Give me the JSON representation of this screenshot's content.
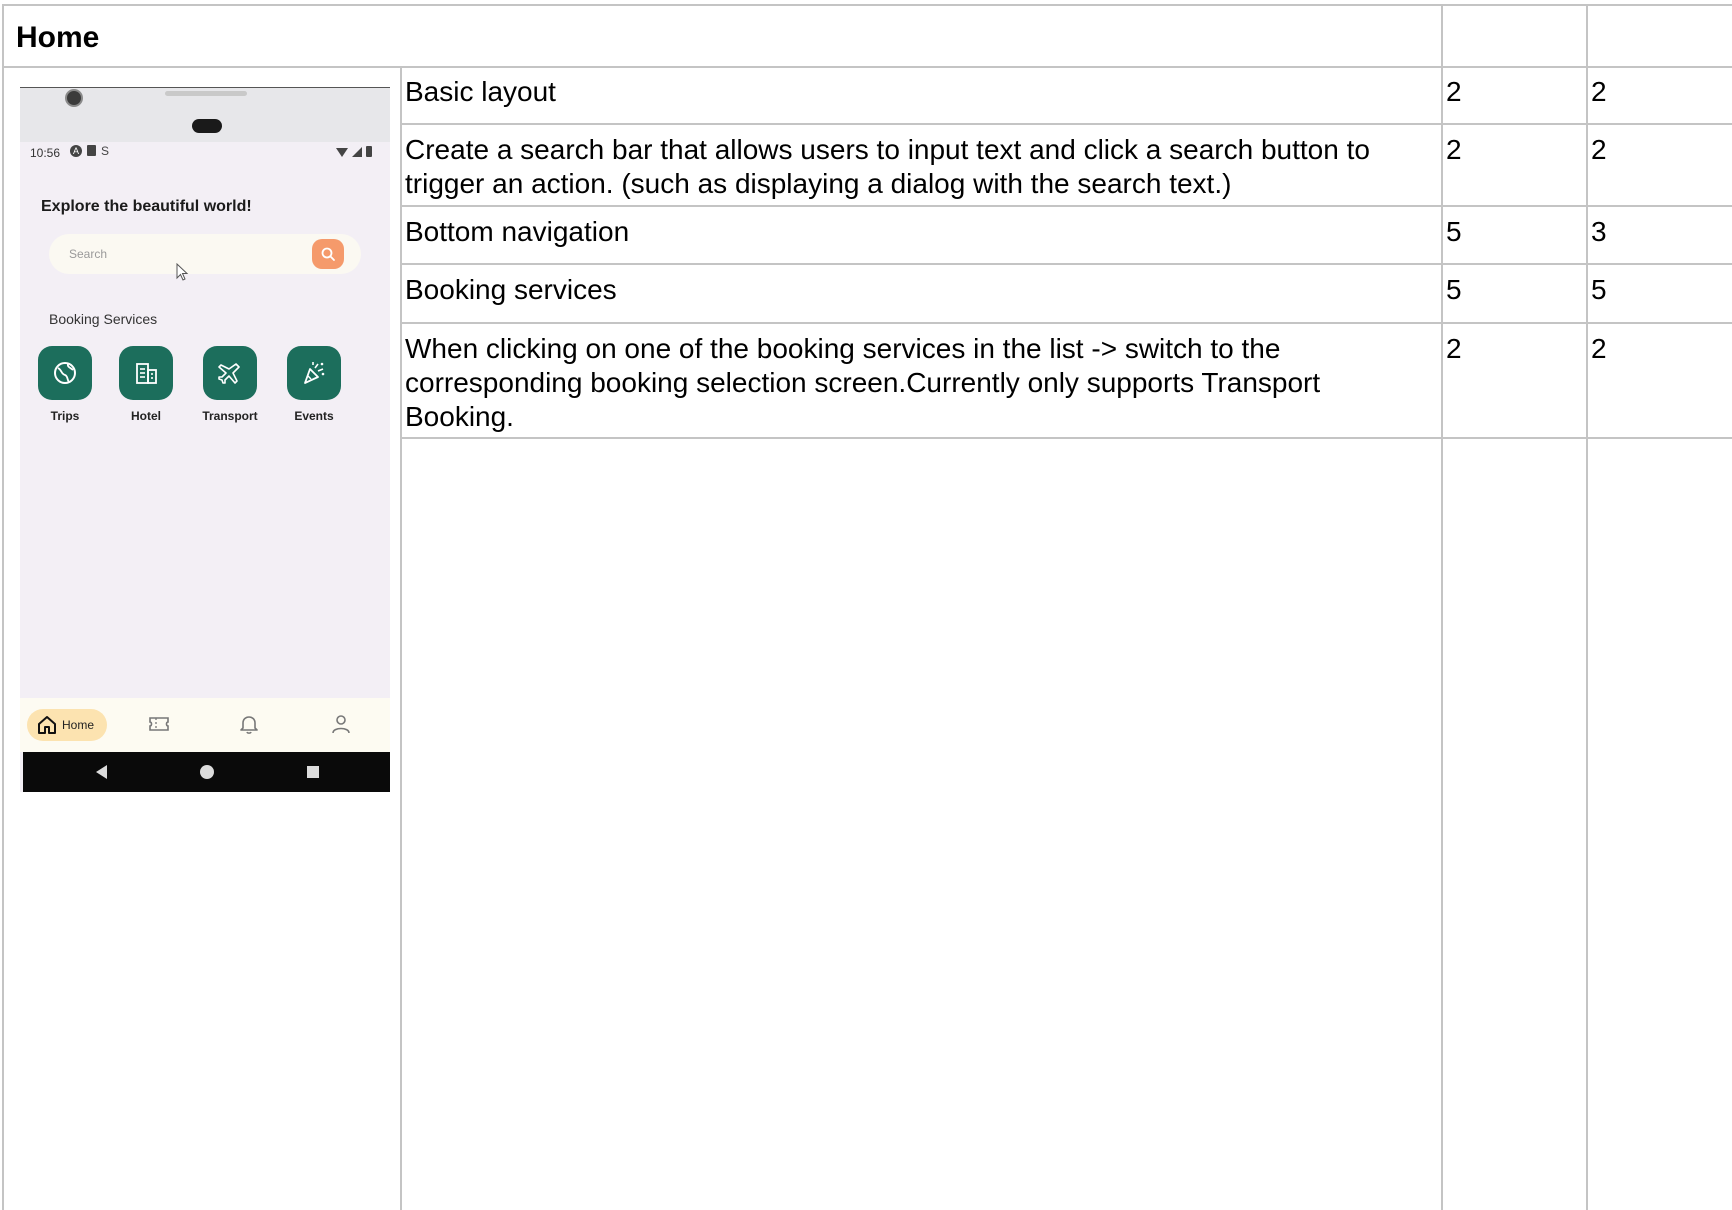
{
  "section_title": "Home",
  "rows": [
    {
      "requirement": "Basic layout",
      "col_a": "2",
      "col_b": "2"
    },
    {
      "requirement": "Create a search bar that allows users to input text and click a search button to trigger an action. (such as displaying a dialog with the search text.)",
      "col_a": "2",
      "col_b": "2"
    },
    {
      "requirement": "Bottom navigation",
      "col_a": "5",
      "col_b": "3"
    },
    {
      "requirement": "Booking services",
      "col_a": "5",
      "col_b": "5"
    },
    {
      "requirement": "When clicking on one of the booking services in the list -> switch to the corresponding booking selection screen.Currently only supports Transport Booking.",
      "col_a": "2",
      "col_b": "2"
    }
  ],
  "phone": {
    "status_time": "10:56",
    "headline": "Explore the beautiful world!",
    "search_placeholder": "Search",
    "booking_services_label": "Booking Services",
    "services": [
      {
        "label": "Trips",
        "icon": "globe-icon"
      },
      {
        "label": "Hotel",
        "icon": "building-icon"
      },
      {
        "label": "Transport",
        "icon": "airplane-icon"
      },
      {
        "label": "Events",
        "icon": "party-popper-icon"
      }
    ],
    "nav": {
      "home_label": "Home",
      "items": [
        "home-icon",
        "ticket-icon",
        "bell-icon",
        "profile-icon"
      ]
    },
    "colors": {
      "service_bg": "#1c6e5c",
      "search_button": "#f59a6b",
      "home_chip": "#fce3b0",
      "screen_bg": "#f3eff5"
    }
  }
}
